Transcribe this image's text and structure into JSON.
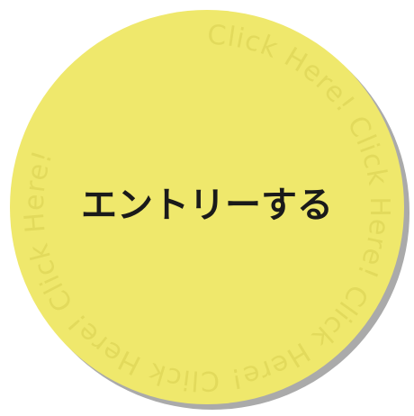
{
  "entry_button": {
    "label": "エントリーする",
    "ring_text": "Click Here!  Click Here!  Click Here!  Click Here!  Click Here!  ",
    "colors": {
      "fill": "#efe86c",
      "shadow": "#aaaaaa",
      "ring_text": "#e2da5c",
      "label": "#1a1a1a"
    }
  }
}
